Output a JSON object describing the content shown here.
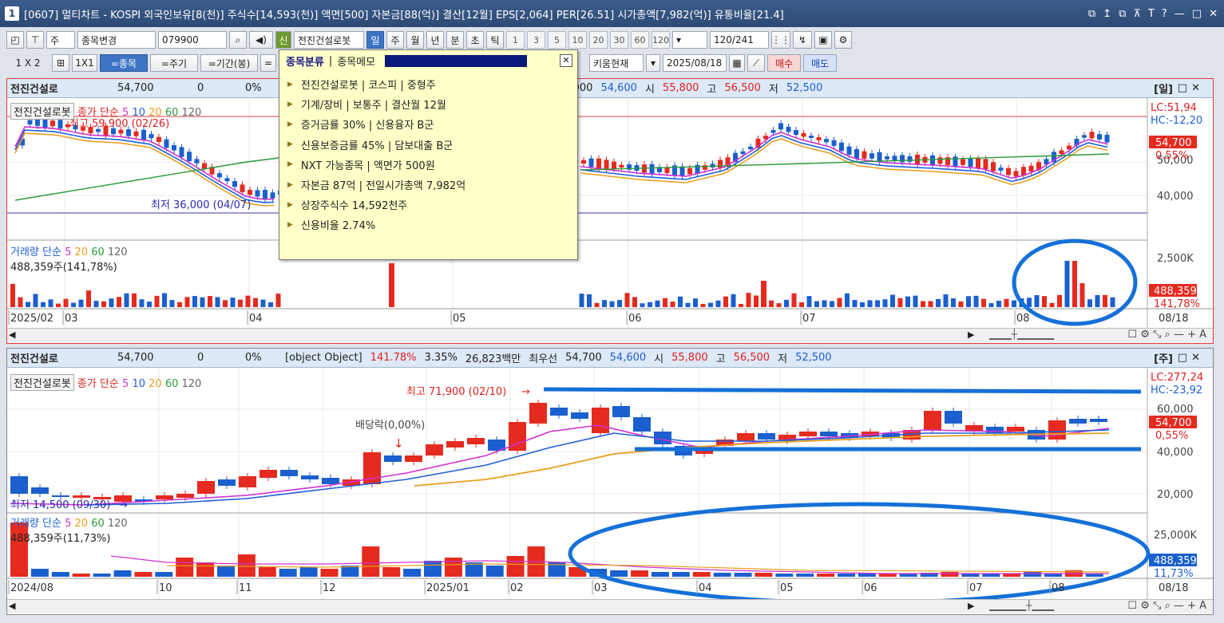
{
  "title": {
    "num": "1",
    "text": "[0607] 멀티차트 - KOSPI 외국인보유[8(천)] 주식수[14,593(천)] 액면[500] 자본금[88(억)] 결산[12월] EPS[2,064] PER[26.51] 시가총액[7,982(억)] 유통비율[21.4]",
    "controls": [
      "⧉",
      "↥",
      "⧉",
      "⊼",
      "T",
      "?",
      "—",
      "□",
      "✕"
    ]
  },
  "toolbar1": {
    "market": "주",
    "change": "종목변경",
    "code": "079900",
    "credit": "신",
    "name": "전진건설로봇",
    "periods": [
      "일",
      "주",
      "월",
      "년",
      "분",
      "초",
      "틱"
    ],
    "intervals": [
      "1",
      "3",
      "5",
      "10",
      "20",
      "30",
      "60",
      "120"
    ],
    "count": "120/241"
  },
  "toolbar2": {
    "layout": "1 X 2",
    "one": "1X1",
    "by_stock": "=종목",
    "by_period": "=주기",
    "by_range": "=기간(봉)",
    "broker": "키움현재",
    "date": "2025/08/18",
    "buy": "매수",
    "sell": "매도"
  },
  "popup": {
    "tab1": "종목분류",
    "tab2": "종목메모",
    "items": [
      "전진건설로봇 | 코스피 | 중형주",
      "기계/장비 | 보통주 | 결산월 12월",
      "증거금률 30% | 신용융자 B군",
      "신용보증금률 45% | 담보대출 B군",
      "NXT 가능종목 | 액면가 500원",
      "자본금 87억 | 전일시가총액 7,982억",
      "상장주식수 14,592천주",
      "신용비율 2.74%"
    ]
  },
  "pane1": {
    "name": "전진건설로",
    "price": "54,700",
    "chg": "0",
    "pct": "0%",
    "best_label": "900",
    "bid": "54,600",
    "open_l": "시",
    "open": "55,800",
    "high_l": "고",
    "high": "56,500",
    "low_l": "저",
    "low": "52,500",
    "period": "[일]",
    "legend": {
      "box": "전진건설로봇",
      "ma": "종가 단순",
      "m5": "5",
      "m10": "10",
      "m20": "20",
      "m60": "60",
      "m120": "120"
    },
    "maxlabel": "최고 59,900 (02/26)",
    "minlabel": "최저 36,000 (04/07)",
    "lc": "LC:51,94",
    "hc": "HC:-12,20",
    "cur": "54,700",
    "curpct": "0.55%",
    "ytick1": "40,000",
    "ytick0": "50,000",
    "vol": {
      "legend": "거래량 단순",
      "m5": "5",
      "m20": "20",
      "m60": "60",
      "m120": "120",
      "value": "488,359주(141,78%)",
      "ytick": "2,500K",
      "cur": "488,359",
      "curpct": "141,78%"
    },
    "xlabels": [
      "2025/02",
      "03",
      "04",
      "05",
      "06",
      "07",
      "08"
    ],
    "enddate": "08/18"
  },
  "pane2": {
    "name": "전진건설로",
    "price": "54,700",
    "chg": "0",
    "pct": "0%",
    "vol": {
      "legend": "거래량 단순",
      "m5": "5",
      "m20": "20",
      "m60": "60",
      "m120": "120",
      "value": "488,359주(11,73%)",
      "ytick": "25,000K",
      "cur": "488,359",
      "curpct": "11,73%"
    },
    "volpct": "141.78%",
    "turn": "3.35%",
    "amount": "26,823백만",
    "best_l": "최우선",
    "best": "54,700",
    "bid": "54,600",
    "open_l": "시",
    "open": "55,800",
    "high_l": "고",
    "high": "56,500",
    "low_l": "저",
    "low": "52,500",
    "period": "[주]",
    "legend": {
      "box": "전진건설로봇",
      "ma": "종가 단순",
      "m5": "5",
      "m10": "10",
      "m20": "20",
      "m60": "60",
      "m120": "120"
    },
    "maxlabel": "최고 71,900 (02/10)",
    "minlabel": "최저 14,500 (09/30)",
    "divlabel": "배당락(0,00%)",
    "lc": "LC:277,24",
    "hc": "HC:-23,92",
    "cur": "54,700",
    "curpct": "0,55%",
    "yticks": [
      "60,000",
      "40,000",
      "20,000"
    ],
    "xlabels": [
      "2024/08",
      "10",
      "11",
      "12",
      "2025/01",
      "02",
      "03",
      "04",
      "05",
      "06",
      "07",
      "08"
    ],
    "enddate": "08/18"
  },
  "colors": {
    "up": "#e52a20",
    "down": "#1b5fcf",
    "annotation": "#1570d8"
  }
}
